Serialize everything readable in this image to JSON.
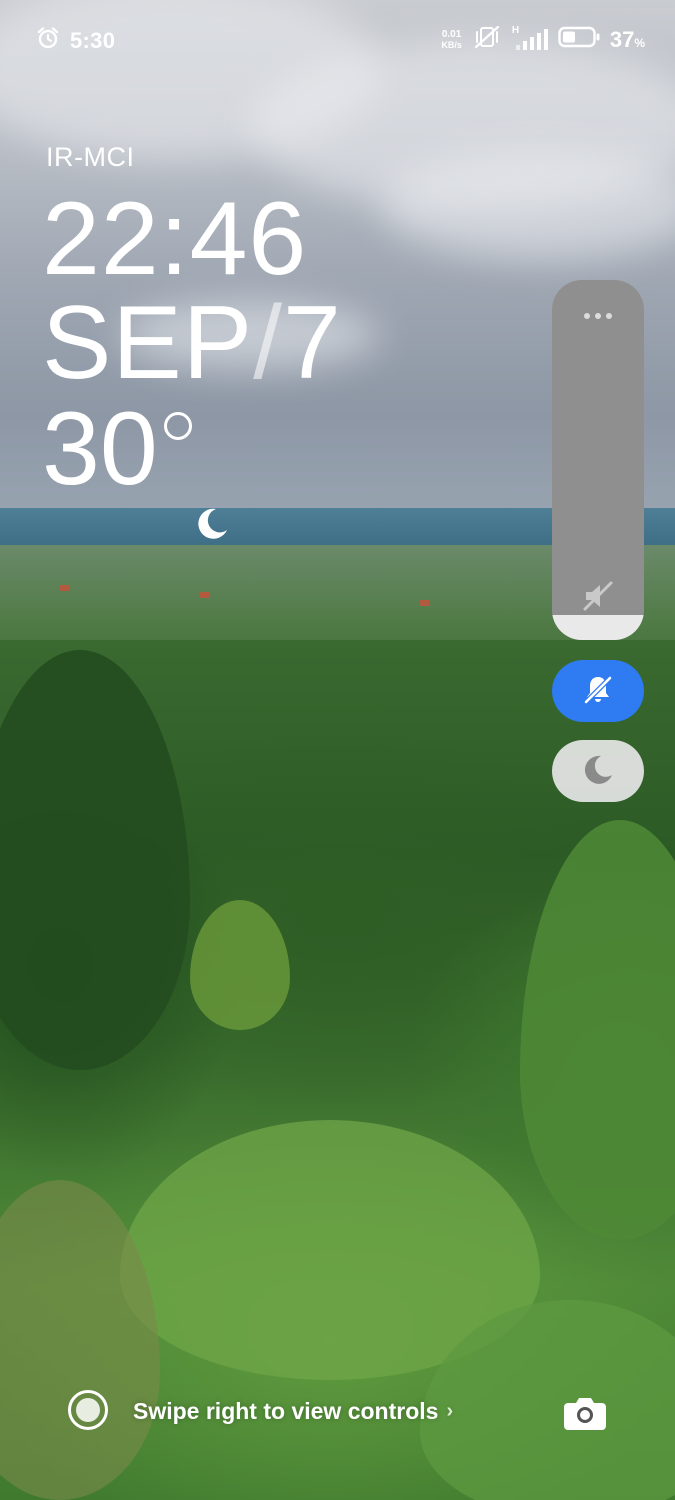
{
  "status_bar": {
    "time": "5:30",
    "net_speed_value": "0.01",
    "net_speed_unit": "KB/s",
    "signal_label": "H",
    "battery_percent": "37",
    "percent_sign": "%",
    "icons": [
      "alarm-icon",
      "mute-vibrate-off-icon",
      "signal-icon",
      "battery-icon"
    ]
  },
  "lock_screen": {
    "carrier": "IR-MCI",
    "time": "22:46",
    "date_month": "SEP",
    "date_sep": "/",
    "date_day": "7",
    "temperature": "30",
    "weather_icon": "moon-icon"
  },
  "volume_panel": {
    "level": 0.07,
    "icons": [
      "more-dots-icon",
      "volume-muted-icon",
      "bell-off-icon",
      "moon-icon"
    ],
    "accent": "#2e7bf2"
  },
  "bottom_bar": {
    "hint": "Swipe right to view controls",
    "hint_chevron": "›",
    "icons": [
      "controls-circle-icon",
      "camera-icon"
    ]
  }
}
